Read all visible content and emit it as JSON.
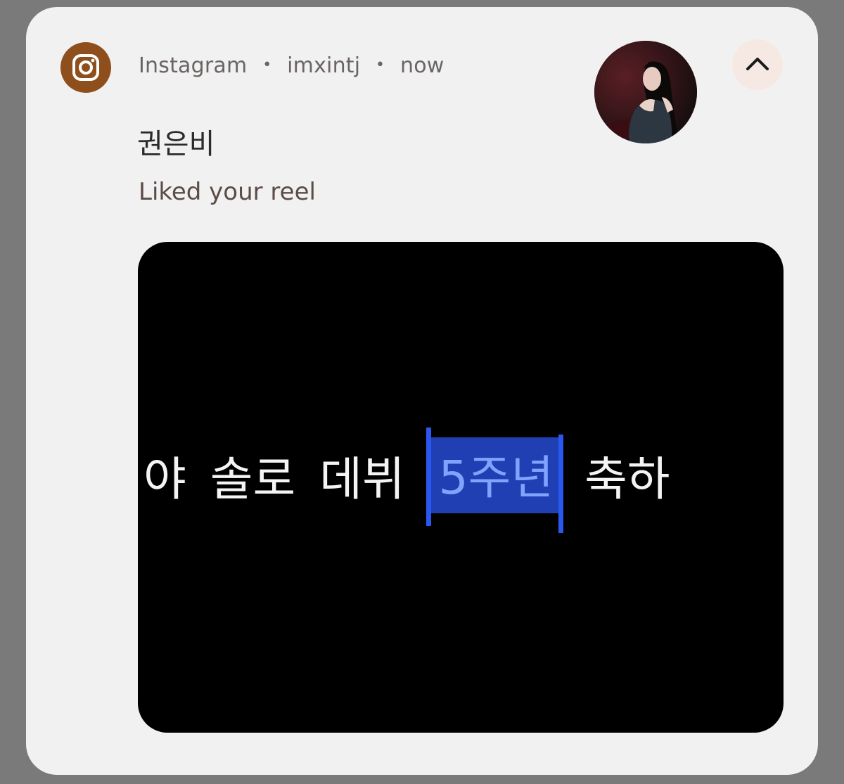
{
  "notification": {
    "app_name": "Instagram",
    "account": "imxintj",
    "time": "now",
    "separator": "•",
    "sender_name": "권은비",
    "message": "Liked your reel"
  },
  "icons": {
    "app_icon": "instagram-icon",
    "collapse": "chevron-up-icon"
  },
  "reel_preview": {
    "caption_segments": [
      "야",
      "솔로",
      "데뷔",
      "5주년",
      "축하"
    ],
    "highlighted_segment_index": 3
  },
  "colors": {
    "app_icon_bg": "#8e4f1d",
    "card_bg": "#f1f1f1",
    "highlight_bg": "#1f3fb3",
    "highlight_text": "#7fa3ff"
  }
}
